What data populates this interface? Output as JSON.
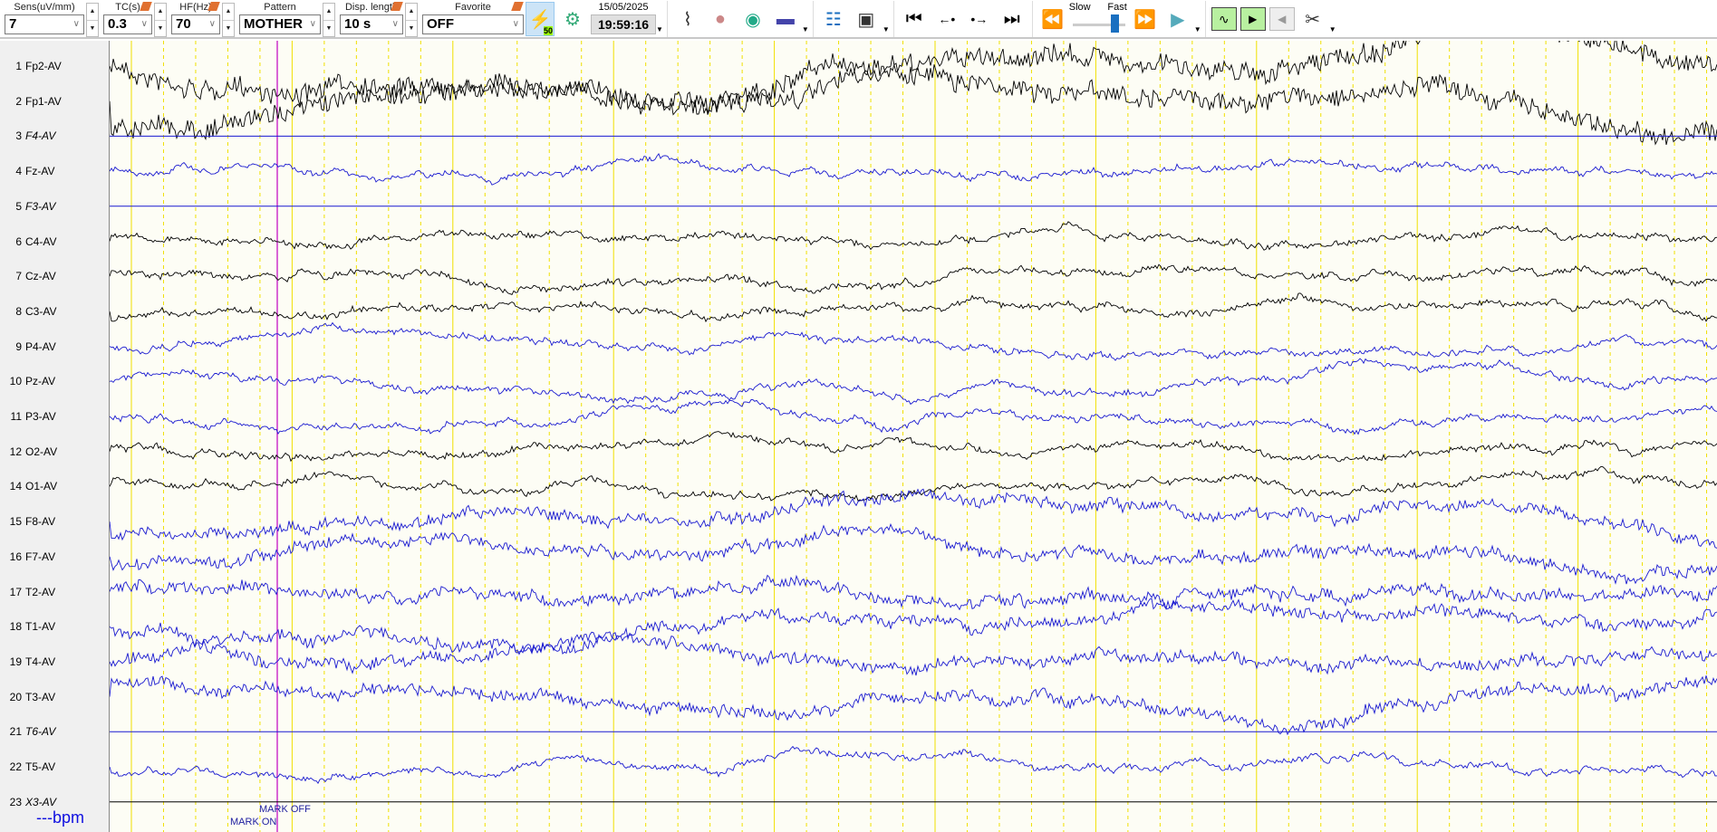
{
  "toolbar": {
    "sens": {
      "label": "Sens(uV/mm)",
      "value": "7"
    },
    "tc": {
      "label": "TC(s)",
      "value": "0.3"
    },
    "hf": {
      "label": "HF(Hz)",
      "value": "70"
    },
    "pattern": {
      "label": "Pattern",
      "value": "MOTHER"
    },
    "disp_length": {
      "label": "Disp. length",
      "value": "10 s"
    },
    "favorite": {
      "label": "Favorite",
      "value": "OFF"
    },
    "notch_badge": "50",
    "date": "15/05/2025",
    "time": "19:59:16",
    "speed_slow": "Slow",
    "speed_fast": "Fast",
    "speed_value": 0.85
  },
  "channels": [
    {
      "num": "1",
      "name": "Fp2-AV",
      "color": "#000000",
      "italic": false
    },
    {
      "num": "2",
      "name": "Fp1-AV",
      "color": "#000000",
      "italic": false
    },
    {
      "num": "3",
      "name": "F4-AV",
      "color": "#1a1ad0",
      "italic": true
    },
    {
      "num": "4",
      "name": "Fz-AV",
      "color": "#1a1ad0",
      "italic": false
    },
    {
      "num": "5",
      "name": "F3-AV",
      "color": "#1a1ad0",
      "italic": true
    },
    {
      "num": "6",
      "name": "C4-AV",
      "color": "#000000",
      "italic": false
    },
    {
      "num": "7",
      "name": "Cz-AV",
      "color": "#000000",
      "italic": false
    },
    {
      "num": "8",
      "name": "C3-AV",
      "color": "#000000",
      "italic": false
    },
    {
      "num": "9",
      "name": "P4-AV",
      "color": "#1a1ad0",
      "italic": false
    },
    {
      "num": "10",
      "name": "Pz-AV",
      "color": "#1a1ad0",
      "italic": false
    },
    {
      "num": "11",
      "name": "P3-AV",
      "color": "#1a1ad0",
      "italic": false
    },
    {
      "num": "12",
      "name": "O2-AV",
      "color": "#000000",
      "italic": false
    },
    {
      "num": "14",
      "name": "O1-AV",
      "color": "#000000",
      "italic": false
    },
    {
      "num": "15",
      "name": "F8-AV",
      "color": "#1a1ad0",
      "italic": false
    },
    {
      "num": "16",
      "name": "F7-AV",
      "color": "#1a1ad0",
      "italic": false
    },
    {
      "num": "17",
      "name": "T2-AV",
      "color": "#1a1ad0",
      "italic": false
    },
    {
      "num": "18",
      "name": "T1-AV",
      "color": "#1a1ad0",
      "italic": false
    },
    {
      "num": "19",
      "name": "T4-AV",
      "color": "#1a1ad0",
      "italic": false
    },
    {
      "num": "20",
      "name": "T3-AV",
      "color": "#1a1ad0",
      "italic": false
    },
    {
      "num": "21",
      "name": "T6-AV",
      "color": "#1a1ad0",
      "italic": true
    },
    {
      "num": "22",
      "name": "T5-AV",
      "color": "#1a1ad0",
      "italic": false
    },
    {
      "num": "23",
      "name": "X3-AV",
      "color": "#000000",
      "italic": true
    }
  ],
  "heart_rate": "---bpm",
  "marks": {
    "off": "MARK OFF",
    "on": "MARK ON"
  }
}
